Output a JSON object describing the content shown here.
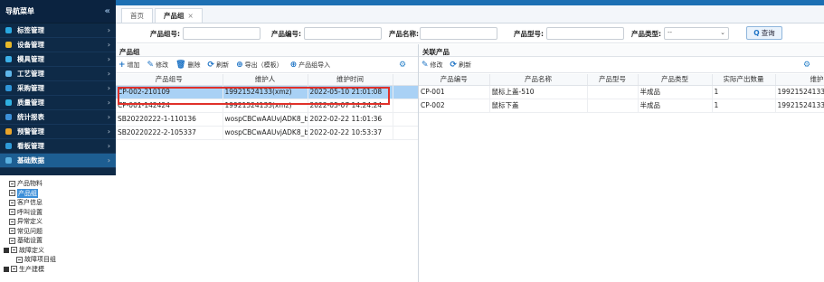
{
  "sidebar": {
    "title": "导航菜单",
    "collapse_glyph": "«",
    "items": [
      {
        "label": "标签管理",
        "icon": "tag-icon",
        "color": "#29a8e0"
      },
      {
        "label": "设备管理",
        "icon": "device-icon",
        "color": "#e8b92a"
      },
      {
        "label": "模具管理",
        "icon": "mold-icon",
        "color": "#3cb0e8"
      },
      {
        "label": "工艺管理",
        "icon": "process-icon",
        "color": "#5fb6ea"
      },
      {
        "label": "采购管理",
        "icon": "cart-icon",
        "color": "#2f95d8"
      },
      {
        "label": "质量管理",
        "icon": "quality-icon",
        "color": "#2fb0e0"
      },
      {
        "label": "统计报表",
        "icon": "chart-icon",
        "color": "#3c90d8"
      },
      {
        "label": "预警管理",
        "icon": "warning-icon",
        "color": "#e8a42a"
      },
      {
        "label": "看板管理",
        "icon": "board-icon",
        "color": "#2f9ad8"
      },
      {
        "label": "基础数据",
        "icon": "database-icon",
        "color": "#5ab0e0"
      }
    ],
    "tree": [
      {
        "label": "产品物料",
        "level": 1
      },
      {
        "label": "产品组",
        "level": 1,
        "selected": true
      },
      {
        "label": "客户信息",
        "level": 1
      },
      {
        "label": "呼叫设置",
        "level": 1
      },
      {
        "label": "异常定义",
        "level": 1
      },
      {
        "label": "常见问题",
        "level": 1
      },
      {
        "label": "基础设置",
        "level": 1
      },
      {
        "label": "故障定义",
        "level": 0
      },
      {
        "label": "故障项目组",
        "level": 2
      },
      {
        "label": "生产建模",
        "level": 0
      }
    ]
  },
  "tabs": [
    {
      "label": "首页"
    },
    {
      "label": "产品组",
      "close": "×",
      "active": true
    }
  ],
  "filter": {
    "group_no_label": "产品组号:",
    "product_no_label": "产品编号:",
    "product_name_label": "产品名称:",
    "product_model_label": "产品型号:",
    "product_type_label": "产品类型:",
    "product_type_value": "--",
    "query_label": "查询"
  },
  "left_panel": {
    "title": "产品组",
    "toolbar": {
      "add": "增加",
      "edit": "修改",
      "delete": "删除",
      "refresh": "刷新",
      "export": "导出（模板）",
      "import": "产品组导入"
    },
    "columns": [
      "产品组号",
      "维护人",
      "维护时间"
    ],
    "rows": [
      {
        "group_no": "CP-002-210109",
        "maintainer": "19921524133(xmz)",
        "time": "2022-05-10 21:01:08",
        "highlight": true
      },
      {
        "group_no": "CP-001-142424",
        "maintainer": "19921524133(xmz)",
        "time": "2022-05-07 14:24:24"
      },
      {
        "group_no": "SB20220222-1-110136",
        "maintainer": "wospCBCwAAUvjADK8_b",
        "time": "2022-02-22 11:01:36"
      },
      {
        "group_no": "SB20220222-2-105337",
        "maintainer": "wospCBCwAAUvjADK8_b",
        "time": "2022-02-22 10:53:37"
      }
    ]
  },
  "right_panel": {
    "title": "关联产品",
    "toolbar": {
      "edit": "修改",
      "refresh": "刷新"
    },
    "columns": [
      "产品编号",
      "产品名称",
      "产品型号",
      "产品类型",
      "实际产出数量",
      "维护"
    ],
    "rows": [
      {
        "no": "CP-001",
        "name": "鼠标上盖-510",
        "model": "",
        "type": "半成品",
        "qty": "1",
        "maint": "19921524133"
      },
      {
        "no": "CP-002",
        "name": "鼠标下盖",
        "model": "",
        "type": "半成品",
        "qty": "1",
        "maint": "19921524133"
      }
    ]
  },
  "accent_color": "#1c6fb3",
  "highlight_row_color": "#a9d1f5"
}
